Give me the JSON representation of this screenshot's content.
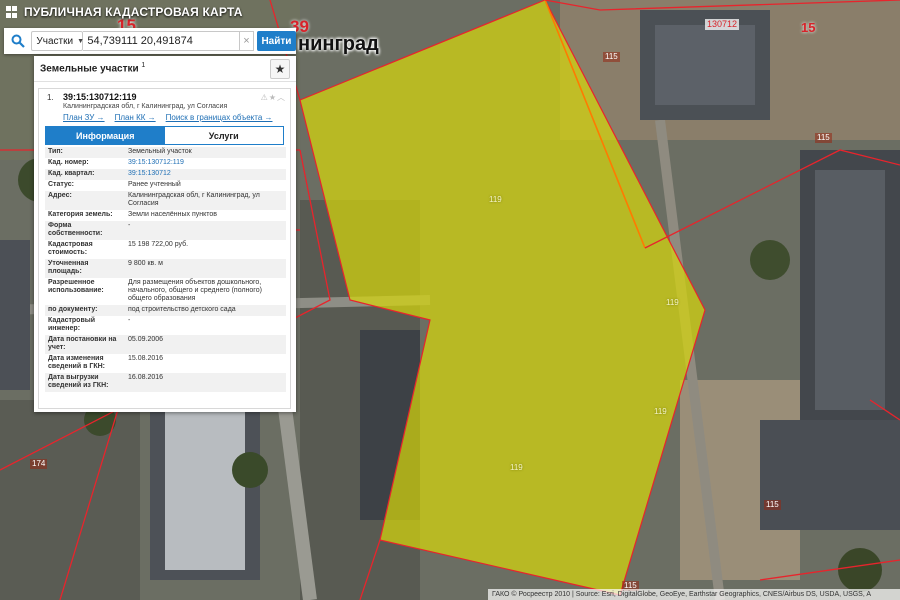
{
  "app": {
    "title": "ПУБЛИЧНАЯ КАДАСТРОВАЯ КАРТА"
  },
  "search": {
    "type": "Участки",
    "value": "54,739111 20,491874",
    "button": "Найти"
  },
  "map": {
    "city": "нинград",
    "big_numbers": [
      "39",
      "15"
    ],
    "top_left_number": "15",
    "quarter_number": "130712",
    "parcel_labels": [
      "119",
      "119",
      "119",
      "119"
    ],
    "plot_labels": [
      "115",
      "115",
      "115",
      "115",
      "174"
    ],
    "attribution": "ГАКО © Росреестр 2010 | Source: Esri, DigitalGlobe, GeoEye, Earthstar Geographics, CNES/Airbus DS, USDA, USGS, A"
  },
  "panel": {
    "title": "Земельные участки",
    "count": "1",
    "result": {
      "index": "1.",
      "cad_number": "39:15:130712:119",
      "address": "Калининградская обл, г Калининград, ул Согласия",
      "links": [
        "План ЗУ →",
        "План КК →",
        "Поиск в границах объекта →"
      ]
    },
    "tabs": {
      "info": "Информация",
      "services": "Услуги"
    },
    "rows": [
      {
        "key": "Тип:",
        "value": "Земельный участок"
      },
      {
        "key": "Кад. номер:",
        "value": "39:15:130712:119"
      },
      {
        "key": "Кад. квартал:",
        "value": "39:15:130712"
      },
      {
        "key": "Статус:",
        "value": "Ранее учтенный"
      },
      {
        "key": "Адрес:",
        "value": "Калининградская обл, г Калининград, ул Согласия"
      },
      {
        "key": "Категория земель:",
        "value": "Земли населённых пунктов"
      },
      {
        "key": "Форма собственности:",
        "value": "-"
      },
      {
        "key": "Кадастровая стоимость:",
        "value": "15 198 722,00 руб."
      },
      {
        "key": "Уточненная площадь:",
        "value": "9 800 кв. м"
      },
      {
        "key": "Разрешенное использование:",
        "value": "Для размещения объектов дошкольного, начального, общего и среднего (полного) общего образования"
      },
      {
        "key": "по документу:",
        "value": "под строительство детского сада"
      },
      {
        "key": "Кадастровый инженер:",
        "value": "-"
      },
      {
        "key": "Дата постановки на учет:",
        "value": "05.09.2006"
      },
      {
        "key": "Дата изменения сведений в ГКН:",
        "value": "15.08.2016"
      },
      {
        "key": "Дата выгрузки сведений из ГКН:",
        "value": "16.08.2016"
      }
    ]
  },
  "colors": {
    "parcel_fill": "#d8d80a",
    "boundary": "#e8242c",
    "accent": "#1f7ec9"
  }
}
